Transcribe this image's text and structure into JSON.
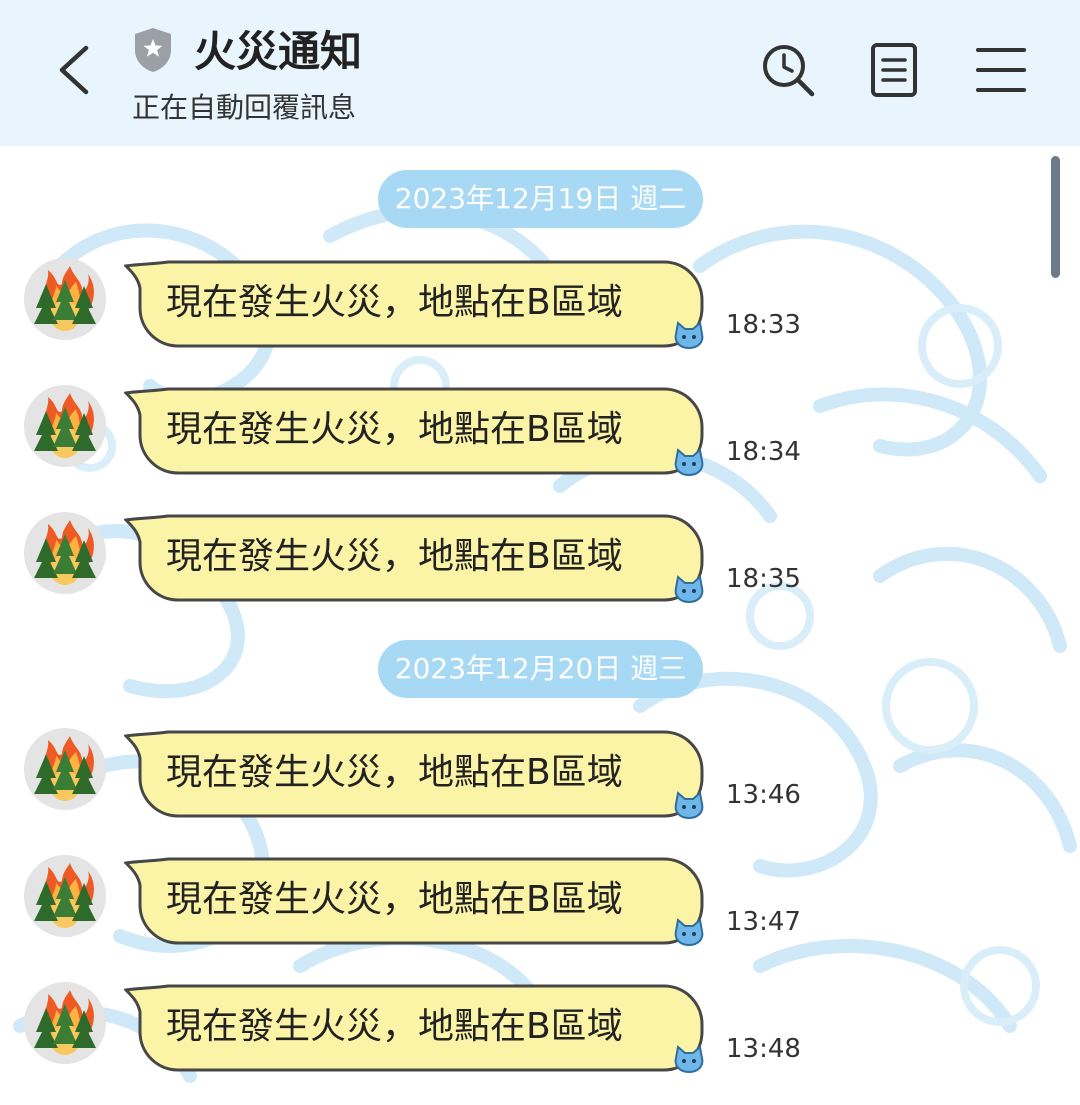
{
  "header": {
    "title": "火災通知",
    "subtitle": "正在自動回覆訊息",
    "back_icon": "chevron-left-icon",
    "badge_icon": "shield-star-icon",
    "actions": [
      "search-clock-icon",
      "notes-icon",
      "menu-icon"
    ],
    "background": "#e9f5fd"
  },
  "chat": {
    "date_divider_1": "2023年12月19日 週二",
    "date_divider_2": "2023年12月20日 週三",
    "bubble_color": "#fbf3a6",
    "divider_color": "#a7d9f5",
    "messages": [
      {
        "text": "現在發生火災，地點在B區域",
        "time": "18:33"
      },
      {
        "text": "現在發生火災，地點在B區域",
        "time": "18:34"
      },
      {
        "text": "現在發生火災，地點在B區域",
        "time": "18:35"
      },
      {
        "text": "現在發生火災，地點在B區域",
        "time": "13:46"
      },
      {
        "text": "現在發生火災，地點在B區域",
        "time": "13:47"
      },
      {
        "text": "現在發生火災，地點在B區域",
        "time": "13:48"
      }
    ]
  }
}
